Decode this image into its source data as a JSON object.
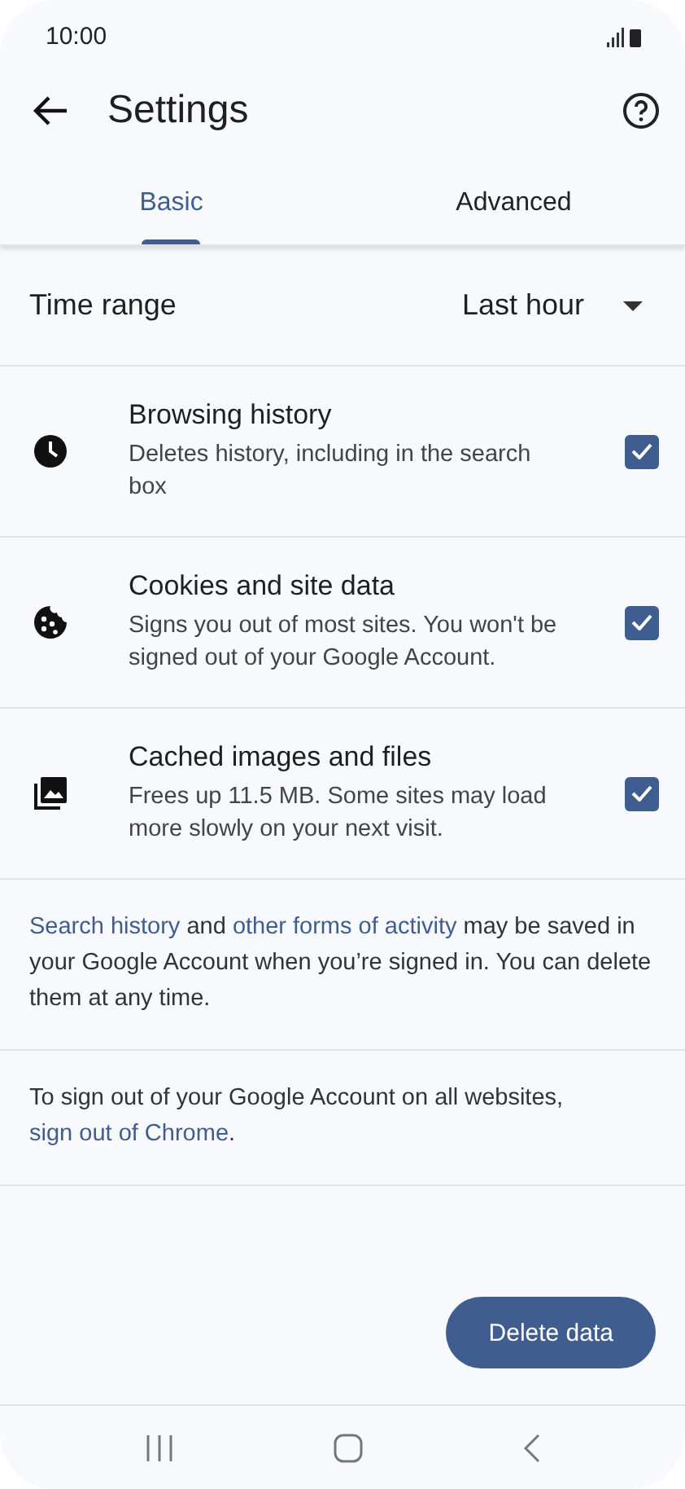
{
  "status_bar": {
    "time": "10:00"
  },
  "toolbar": {
    "title": "Settings"
  },
  "tabs": [
    {
      "label": "Basic",
      "selected": true
    },
    {
      "label": "Advanced",
      "selected": false
    }
  ],
  "time_range": {
    "label": "Time range",
    "value": "Last hour"
  },
  "items": [
    {
      "title": "Browsing history",
      "description": "Deletes history, including in the search box",
      "checked": true
    },
    {
      "title": "Cookies and site data",
      "description": "Signs you out of most sites. You won't be signed out of your Google Account.",
      "checked": true
    },
    {
      "title": "Cached images and files",
      "description": "Frees up 11.5 MB. Some sites may load more slowly on your next visit.",
      "checked": true
    }
  ],
  "notes": [
    [
      {
        "text": "Search history",
        "link": true
      },
      {
        "text": " and ",
        "link": false
      },
      {
        "text": "other forms of activity",
        "link": true
      },
      {
        "text": " may be saved in your Google Account when you’re signed in. You can delete them at any time.",
        "link": false
      }
    ],
    [
      {
        "text": "To sign out of your Google Account on all websites, ",
        "link": false
      },
      {
        "text": "sign out of Chrome",
        "link": true
      },
      {
        "text": ".",
        "link": false
      }
    ]
  ],
  "delete_button": "Delete data"
}
